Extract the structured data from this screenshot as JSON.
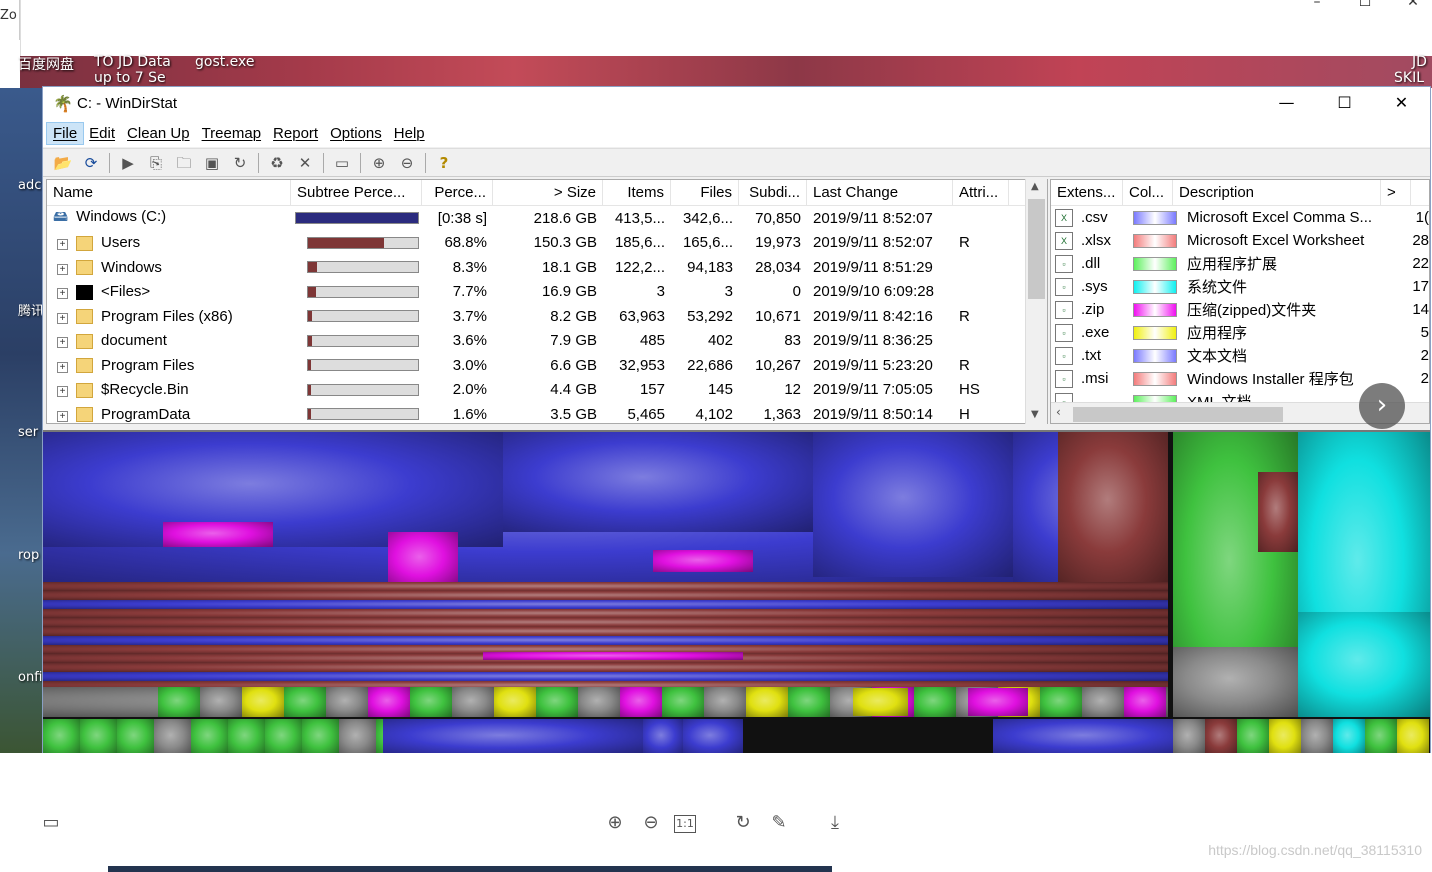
{
  "viewer": {
    "left_clip_text": "Zo",
    "controls": [
      "–",
      "☐",
      "✕"
    ],
    "desktop_labels": [
      "百度网盘",
      "TO JD Data",
      "up to 7 Se",
      "gost.exe",
      "JD",
      "SKIL"
    ],
    "desktop_left_labels": [
      "adc",
      "腾讯",
      "ser",
      "rop",
      "onfi"
    ],
    "bottom_icons": [
      "thumbnails-icon",
      "zoom-in-icon",
      "zoom-out-icon",
      "actual-size-icon",
      "rotate-icon",
      "edit-icon",
      "download-icon"
    ],
    "actual_size_label": "1:1",
    "watermark": "https://blog.csdn.net/qq_38115310"
  },
  "window": {
    "title": "C: - WinDirStat",
    "controls": {
      "minimize": "—",
      "maximize": "☐",
      "close": "✕"
    }
  },
  "menu": [
    "File",
    "Edit",
    "Clean Up",
    "Treemap",
    "Report",
    "Options",
    "Help"
  ],
  "toolbar": [
    "open-icon",
    "refresh-icon",
    "|",
    "play-icon",
    "copy-icon",
    "explorer-icon",
    "cmd-icon",
    "refresh-selected-icon",
    "|",
    "recycle-icon",
    "delete-icon",
    "|",
    "properties-icon",
    "|",
    "zoom-in-icon",
    "zoom-out-icon",
    "|",
    "help-icon"
  ],
  "directory": {
    "columns": [
      "Name",
      "Subtree Perce...",
      "Perce...",
      "> Size",
      "Items",
      "Files",
      "Subdi...",
      "Last Change",
      "Attri..."
    ],
    "rows": [
      {
        "name": "Windows (C:)",
        "bar": 1.0,
        "percent": "[0:38 s]",
        "size": "218.6 GB",
        "items": "413,5...",
        "files": "342,6...",
        "subdirs": "70,850",
        "last_change": "2019/9/11  8:52:07",
        "attr": "",
        "type": "drive"
      },
      {
        "name": "Users",
        "bar": 0.688,
        "percent": "68.8%",
        "size": "150.3 GB",
        "items": "185,6...",
        "files": "165,6...",
        "subdirs": "19,973",
        "last_change": "2019/9/11  8:52:07",
        "attr": "R",
        "type": "folder"
      },
      {
        "name": "Windows",
        "bar": 0.083,
        "percent": "8.3%",
        "size": "18.1 GB",
        "items": "122,2...",
        "files": "94,183",
        "subdirs": "28,034",
        "last_change": "2019/9/11  8:51:29",
        "attr": "",
        "type": "folder"
      },
      {
        "name": "<Files>",
        "bar": 0.077,
        "percent": "7.7%",
        "size": "16.9 GB",
        "items": "3",
        "files": "3",
        "subdirs": "0",
        "last_change": "2019/9/10  6:09:28",
        "attr": "",
        "type": "files"
      },
      {
        "name": "Program Files (x86)",
        "bar": 0.037,
        "percent": "3.7%",
        "size": "8.2 GB",
        "items": "63,963",
        "files": "53,292",
        "subdirs": "10,671",
        "last_change": "2019/9/11  8:42:16",
        "attr": "R",
        "type": "folder"
      },
      {
        "name": "document",
        "bar": 0.036,
        "percent": "3.6%",
        "size": "7.9 GB",
        "items": "485",
        "files": "402",
        "subdirs": "83",
        "last_change": "2019/9/11  8:36:25",
        "attr": "",
        "type": "folder"
      },
      {
        "name": "Program Files",
        "bar": 0.03,
        "percent": "3.0%",
        "size": "6.6 GB",
        "items": "32,953",
        "files": "22,686",
        "subdirs": "10,267",
        "last_change": "2019/9/11  5:23:20",
        "attr": "R",
        "type": "folder"
      },
      {
        "name": "$Recycle.Bin",
        "bar": 0.02,
        "percent": "2.0%",
        "size": "4.4 GB",
        "items": "157",
        "files": "145",
        "subdirs": "12",
        "last_change": "2019/9/11  7:05:05",
        "attr": "HS",
        "type": "folder"
      },
      {
        "name": "ProgramData",
        "bar": 0.016,
        "percent": "1.6%",
        "size": "3.5 GB",
        "items": "5,465",
        "files": "4,102",
        "subdirs": "1,363",
        "last_change": "2019/9/11  8:50:14",
        "attr": "H",
        "type": "folder"
      }
    ]
  },
  "extensions": {
    "columns": [
      "Extens...",
      "Col...",
      "Description",
      ">"
    ],
    "rows": [
      {
        "ext": ".csv",
        "color": "#7b7bff",
        "desc": "Microsoft Excel Comma S...",
        "count": "1("
      },
      {
        "ext": ".xlsx",
        "color": "#f37c7c",
        "desc": "Microsoft Excel Worksheet",
        "count": "28"
      },
      {
        "ext": ".dll",
        "color": "#5df05d",
        "desc": "应用程序扩展",
        "count": "22"
      },
      {
        "ext": ".sys",
        "color": "#10f0f0",
        "desc": "系统文件",
        "count": "17"
      },
      {
        "ext": ".zip",
        "color": "#f010f0",
        "desc": "压缩(zipped)文件夹",
        "count": "14"
      },
      {
        "ext": ".exe",
        "color": "#f0f010",
        "desc": "应用程序",
        "count": "5"
      },
      {
        "ext": ".txt",
        "color": "#7b7bff",
        "desc": "文本文档",
        "count": "2"
      },
      {
        "ext": ".msi",
        "color": "#f37c7c",
        "desc": "Windows Installer 程序包",
        "count": "2"
      },
      {
        "ext": "",
        "color": "#5df05d",
        "desc": "XML 文档",
        "count": ""
      }
    ]
  },
  "colors": {
    "blue": "#3c3ccf",
    "red": "#8a3b3b",
    "green": "#3fc23f",
    "cyan": "#10e0e0",
    "magenta": "#e010e0",
    "yellow": "#e0e010",
    "gray": "#8a8a8a"
  }
}
